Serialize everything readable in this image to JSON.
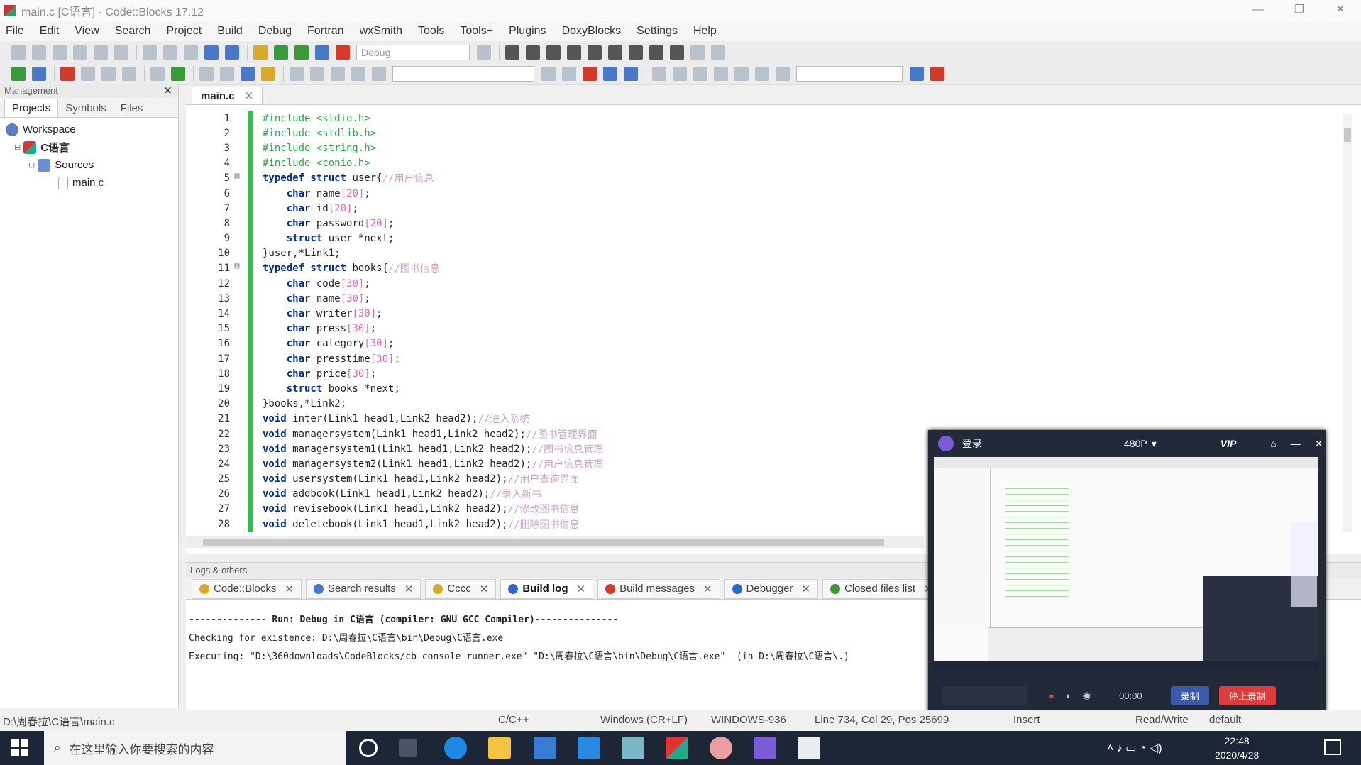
{
  "window": {
    "title": "main.c [C语言] - Code::Blocks 17.12",
    "btn_min": "—",
    "btn_max": "❐",
    "btn_close": "✕"
  },
  "menu": [
    "File",
    "Edit",
    "View",
    "Search",
    "Project",
    "Build",
    "Debug",
    "Fortran",
    "wxSmith",
    "Tools",
    "Tools+",
    "Plugins",
    "DoxyBlocks",
    "Settings",
    "Help"
  ],
  "toolbar": {
    "build_target": "Debug"
  },
  "management": {
    "title": "Management",
    "tabs": [
      "Projects",
      "Symbols",
      "Files"
    ],
    "tree": {
      "workspace": "Workspace",
      "project": "C语言",
      "folder": "Sources",
      "file": "main.c"
    }
  },
  "editor": {
    "tab": "main.c",
    "lines": [
      {
        "n": "1",
        "parts": [
          [
            "pp",
            "#include <stdio.h>"
          ]
        ]
      },
      {
        "n": "2",
        "parts": [
          [
            "pp",
            "#include <stdlib.h>"
          ]
        ]
      },
      {
        "n": "3",
        "parts": [
          [
            "pp",
            "#include <string.h>"
          ]
        ]
      },
      {
        "n": "4",
        "parts": [
          [
            "pp",
            "#include <conio.h>"
          ]
        ]
      },
      {
        "n": "5",
        "fold": true,
        "parts": [
          [
            "kw",
            "typedef struct"
          ],
          [
            "tx",
            " user{"
          ],
          [
            "cm",
            "//用户信息"
          ]
        ]
      },
      {
        "n": "6",
        "parts": [
          [
            "tx",
            "    "
          ],
          [
            "kw",
            "char"
          ],
          [
            "tx",
            " name"
          ],
          [
            "nm",
            "[20]"
          ],
          [
            "tx",
            ";"
          ]
        ]
      },
      {
        "n": "7",
        "parts": [
          [
            "tx",
            "    "
          ],
          [
            "kw",
            "char"
          ],
          [
            "tx",
            " id"
          ],
          [
            "nm",
            "[20]"
          ],
          [
            "tx",
            ";"
          ]
        ]
      },
      {
        "n": "8",
        "parts": [
          [
            "tx",
            "    "
          ],
          [
            "kw",
            "char"
          ],
          [
            "tx",
            " password"
          ],
          [
            "nm",
            "[20]"
          ],
          [
            "tx",
            ";"
          ]
        ]
      },
      {
        "n": "9",
        "parts": [
          [
            "tx",
            "    "
          ],
          [
            "kw",
            "struct"
          ],
          [
            "tx",
            " user *next;"
          ]
        ]
      },
      {
        "n": "10",
        "parts": [
          [
            "tx",
            "}user,*Link1;"
          ]
        ]
      },
      {
        "n": "11",
        "fold": true,
        "parts": [
          [
            "kw",
            "typedef struct"
          ],
          [
            "tx",
            " books{"
          ],
          [
            "cm",
            "//图书信息"
          ]
        ]
      },
      {
        "n": "12",
        "parts": [
          [
            "tx",
            "    "
          ],
          [
            "kw",
            "char"
          ],
          [
            "tx",
            " code"
          ],
          [
            "nm",
            "[30]"
          ],
          [
            "tx",
            ";"
          ]
        ]
      },
      {
        "n": "13",
        "parts": [
          [
            "tx",
            "    "
          ],
          [
            "kw",
            "char"
          ],
          [
            "tx",
            " name"
          ],
          [
            "nm",
            "[30]"
          ],
          [
            "tx",
            ";"
          ]
        ]
      },
      {
        "n": "14",
        "parts": [
          [
            "tx",
            "    "
          ],
          [
            "kw",
            "char"
          ],
          [
            "tx",
            " writer"
          ],
          [
            "nm",
            "[30]"
          ],
          [
            "tx",
            ";"
          ]
        ]
      },
      {
        "n": "15",
        "parts": [
          [
            "tx",
            "    "
          ],
          [
            "kw",
            "char"
          ],
          [
            "tx",
            " press"
          ],
          [
            "nm",
            "[30]"
          ],
          [
            "tx",
            ";"
          ]
        ]
      },
      {
        "n": "16",
        "parts": [
          [
            "tx",
            "    "
          ],
          [
            "kw",
            "char"
          ],
          [
            "tx",
            " category"
          ],
          [
            "nm",
            "[30]"
          ],
          [
            "tx",
            ";"
          ]
        ]
      },
      {
        "n": "17",
        "parts": [
          [
            "tx",
            "    "
          ],
          [
            "kw",
            "char"
          ],
          [
            "tx",
            " presstime"
          ],
          [
            "nm",
            "[30]"
          ],
          [
            "tx",
            ";"
          ]
        ]
      },
      {
        "n": "18",
        "parts": [
          [
            "tx",
            "    "
          ],
          [
            "kw",
            "char"
          ],
          [
            "tx",
            " price"
          ],
          [
            "nm",
            "[30]"
          ],
          [
            "tx",
            ";"
          ]
        ]
      },
      {
        "n": "19",
        "parts": [
          [
            "tx",
            "    "
          ],
          [
            "kw",
            "struct"
          ],
          [
            "tx",
            " books *next;"
          ]
        ]
      },
      {
        "n": "20",
        "parts": [
          [
            "tx",
            "}books,*Link2;"
          ]
        ]
      },
      {
        "n": "21",
        "parts": [
          [
            "kw",
            "void"
          ],
          [
            "tx",
            " inter(Link1 head1,Link2 head2);"
          ],
          [
            "cm",
            "//进入系统"
          ]
        ]
      },
      {
        "n": "22",
        "parts": [
          [
            "kw",
            "void"
          ],
          [
            "tx",
            " managersystem(Link1 head1,Link2 head2);"
          ],
          [
            "cm",
            "//图书管理界面"
          ]
        ]
      },
      {
        "n": "23",
        "parts": [
          [
            "kw",
            "void"
          ],
          [
            "tx",
            " managersystem1(Link1 head1,Link2 head2);"
          ],
          [
            "cm",
            "//图书信息管理"
          ]
        ]
      },
      {
        "n": "24",
        "parts": [
          [
            "kw",
            "void"
          ],
          [
            "tx",
            " managersystem2(Link1 head1,Link2 head2);"
          ],
          [
            "cm",
            "//用户信息管理"
          ]
        ]
      },
      {
        "n": "25",
        "parts": [
          [
            "kw",
            "void"
          ],
          [
            "tx",
            " usersystem(Link1 head1,Link2 head2);"
          ],
          [
            "cm",
            "//用户查询界面"
          ]
        ]
      },
      {
        "n": "26",
        "parts": [
          [
            "kw",
            "void"
          ],
          [
            "tx",
            " addbook(Link1 head1,Link2 head2);"
          ],
          [
            "cm",
            "//录入新书"
          ]
        ]
      },
      {
        "n": "27",
        "parts": [
          [
            "kw",
            "void"
          ],
          [
            "tx",
            " revisebook(Link1 head1,Link2 head2);"
          ],
          [
            "cm",
            "//修改图书信息"
          ]
        ]
      },
      {
        "n": "28",
        "parts": [
          [
            "kw",
            "void"
          ],
          [
            "tx",
            " deletebook(Link1 head1,Link2 head2);"
          ],
          [
            "cm",
            "//删除图书信息"
          ]
        ]
      }
    ]
  },
  "logs": {
    "title": "Logs & others",
    "tabs": [
      {
        "label": "Code::Blocks",
        "color": "#d8a92a"
      },
      {
        "label": "Search results",
        "color": "#4a78c8"
      },
      {
        "label": "Cccc",
        "color": "#d8a92a"
      },
      {
        "label": "Build log",
        "color": "#2a6ad0",
        "active": true
      },
      {
        "label": "Build messages",
        "color": "#d43a2a"
      },
      {
        "label": "Debugger",
        "color": "#2a6ad0"
      },
      {
        "label": "Closed files list",
        "color": "#3a9a3a"
      }
    ],
    "output": [
      "-------------- Run: Debug in C语言 (compiler: GNU GCC Compiler)---------------",
      "Checking for existence: D:\\周春拉\\C语言\\bin\\Debug\\C语言.exe",
      "Executing: \"D:\\360downloads\\CodeBlocks/cb_console_runner.exe\" \"D:\\周春拉\\C语言\\bin\\Debug\\C语言.exe\"  (in D:\\周春拉\\C语言\\.)"
    ]
  },
  "recorder": {
    "login": "登录",
    "quality": "480P",
    "vip": "VIP",
    "time": "00:00",
    "record_btn": "录制",
    "stop_btn": "停止录制"
  },
  "status": {
    "path": "D:\\周春拉\\C语言\\main.c",
    "lang": "C/C++",
    "eol": "Windows (CR+LF)",
    "encoding": "WINDOWS-936",
    "position": "Line 734, Col 29, Pos 25699",
    "mode": "Insert",
    "access": "Read/Write",
    "profile": "default"
  },
  "taskbar": {
    "search_placeholder": "在这里输入你要搜索的内容",
    "time": "22:48",
    "date": "2020/4/28"
  }
}
